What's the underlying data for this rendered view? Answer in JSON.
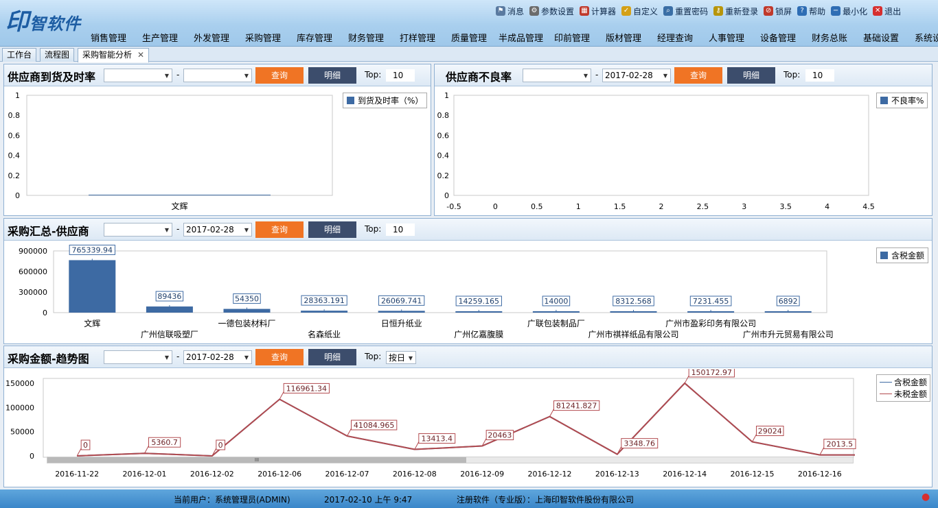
{
  "app": {
    "logo": "印智软件"
  },
  "toplinks": [
    {
      "label": "消息",
      "icon": "flag-icon",
      "color": "#5a7aa0"
    },
    {
      "label": "参数设置",
      "icon": "gear-icon",
      "color": "#6b6b6b"
    },
    {
      "label": "计算器",
      "icon": "calculator-icon",
      "color": "#c0392b"
    },
    {
      "label": "自定义",
      "icon": "checklist-icon",
      "color": "#d4a017"
    },
    {
      "label": "重置密码",
      "icon": "magnifier-icon",
      "color": "#3a6ea5"
    },
    {
      "label": "重新登录",
      "icon": "key-icon",
      "color": "#b7950b"
    },
    {
      "label": "锁屏",
      "icon": "lock-icon",
      "color": "#c0392b"
    },
    {
      "label": "帮助",
      "icon": "help-icon",
      "color": "#2e6db4"
    },
    {
      "label": "最小化",
      "icon": "minimize-icon",
      "color": "#2e6db4"
    },
    {
      "label": "退出",
      "icon": "close-icon",
      "color": "#d62f2f"
    }
  ],
  "menu": [
    "销售管理",
    "生产管理",
    "外发管理",
    "采购管理",
    "库存管理",
    "财务管理",
    "打样管理",
    "质量管理",
    "半成品管理",
    "印前管理",
    "版材管理",
    "经理查询",
    "人事管理",
    "设备管理",
    "财务总账",
    "基础设置",
    "系统设"
  ],
  "tabs": [
    {
      "label": "工作台"
    },
    {
      "label": "流程图"
    },
    {
      "label": "采购智能分析",
      "close": "✕"
    }
  ],
  "common": {
    "query": "查询",
    "detail": "明细",
    "top_label": "Top:",
    "dash": "-"
  },
  "panel1": {
    "title": "供应商到货及时率",
    "date_from": "",
    "date_to": "",
    "top": "10",
    "legend": "到货及时率（%）"
  },
  "panel2": {
    "title": "供应商不良率",
    "date_from": "",
    "date_to": "2017-02-28",
    "top": "10",
    "legend": "不良率%"
  },
  "panel3": {
    "title": "采购汇总-供应商",
    "date_from": "",
    "date_to": "2017-02-28",
    "top": "10",
    "legend": "含税金额"
  },
  "panel4": {
    "title": "采购金额-趋势图",
    "date_from": "",
    "date_to": "2017-02-28",
    "top": "按日",
    "legend": [
      "含税金额",
      "未税金额"
    ],
    "scroll_mark": "III"
  },
  "colors": {
    "accent_orange": "#f07424",
    "btn_dark": "#3c4d6c",
    "bar_blue": "#3d6aa3",
    "line_red": "#b24a4e",
    "line_blue": "#3d6aa3"
  },
  "chart_data": [
    {
      "type": "bar",
      "ylim": [
        0,
        1
      ],
      "yticks": [
        "0",
        "0.2",
        "0.4",
        "0.6",
        "0.8",
        "1"
      ],
      "categories": [
        "文辉"
      ],
      "series": [
        {
          "name": "到货及时率（%）",
          "values": [
            0
          ]
        }
      ]
    },
    {
      "type": "bar",
      "ylim": [
        0,
        1
      ],
      "xlim": [
        -0.5,
        4.5
      ],
      "yticks": [
        "0",
        "0.2",
        "0.4",
        "0.6",
        "0.8",
        "1"
      ],
      "xticks": [
        "-0.5",
        "0",
        "0.5",
        "1",
        "1.5",
        "2",
        "2.5",
        "3",
        "3.5",
        "4",
        "4.5"
      ],
      "categories": [],
      "series": [
        {
          "name": "不良率%",
          "values": []
        }
      ]
    },
    {
      "type": "bar",
      "ylim": [
        0,
        900000
      ],
      "yticks": [
        "0",
        "300000",
        "600000",
        "900000"
      ],
      "categories": [
        "文辉",
        "广州信联吸塑厂",
        "一德包装材料厂",
        "名森纸业",
        "日恒升纸业",
        "广州亿嘉腹膜",
        "广联包装制品厂",
        "广州市祺祥纸品有限公司",
        "广州市盈彩印务有限公司",
        "广州市升元贸易有限公司"
      ],
      "series": [
        {
          "name": "含税金额",
          "values": [
            765339.94,
            89436,
            54350,
            28363.191,
            26069.741,
            14259.165,
            14000,
            8312.568,
            7231.455,
            6892
          ]
        }
      ],
      "data_labels": [
        "765339.94",
        "89436",
        "54350",
        "28363.191",
        "26069.741",
        "14259.165",
        "14000",
        "8312.568",
        "7231.455",
        "6892"
      ]
    },
    {
      "type": "line",
      "ylim": [
        0,
        160000
      ],
      "yticks": [
        "0",
        "50000",
        "100000",
        "150000"
      ],
      "categories": [
        "2016-11-22",
        "2016-12-01",
        "2016-12-02",
        "2016-12-06",
        "2016-12-07",
        "2016-12-08",
        "2016-12-09",
        "2016-12-12",
        "2016-12-13",
        "2016-12-14",
        "2016-12-15",
        "2016-12-16"
      ],
      "series": [
        {
          "name": "含税金额",
          "values": [
            0,
            5360.7,
            0,
            116961.34,
            41084.965,
            13413.4,
            20463,
            81241.827,
            3348.76,
            150172.97,
            29024,
            2013.5
          ]
        },
        {
          "name": "未税金额",
          "values": [
            0,
            5360.7,
            0,
            116961.34,
            41084.965,
            13413.4,
            20463,
            81241.827,
            3348.76,
            150172.97,
            29024,
            2013.5
          ]
        }
      ],
      "data_labels": [
        "0",
        "5360.7",
        "0",
        "116961.34",
        "41084.965",
        "13413.4",
        "20463",
        "81241.827",
        "3348.76",
        "150172.97",
        "29024",
        "2013.5"
      ]
    }
  ],
  "status": {
    "user": "当前用户：系统管理员(ADMIN)",
    "datetime": "2017-02-10 上午 9:47",
    "reg": "注册软件（专业版）：上海印智软件股份有限公司"
  }
}
